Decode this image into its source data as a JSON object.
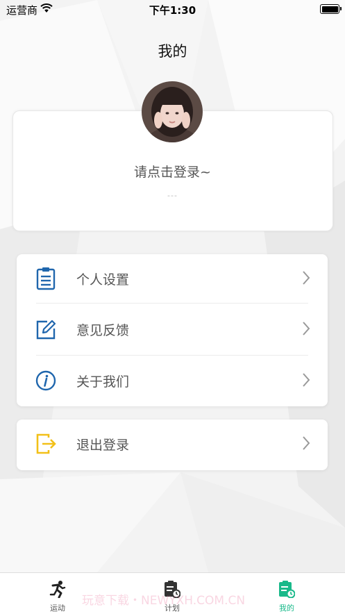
{
  "status_bar": {
    "carrier": "运营商",
    "time": "下午1:30"
  },
  "header": {
    "title": "我的"
  },
  "profile": {
    "login_prompt": "请点击登录~",
    "subtitle": "---"
  },
  "menu": {
    "items": [
      {
        "label": "个人设置",
        "icon": "clipboard-list-icon"
      },
      {
        "label": "意见反馈",
        "icon": "edit-icon"
      },
      {
        "label": "关于我们",
        "icon": "info-icon"
      }
    ]
  },
  "logout": {
    "label": "退出登录",
    "icon": "logout-icon"
  },
  "tabbar": {
    "tabs": [
      {
        "label": "运动",
        "icon": "running-icon"
      },
      {
        "label": "计划",
        "icon": "plan-icon"
      },
      {
        "label": "我的",
        "icon": "profile-icon",
        "active": true
      }
    ]
  },
  "watermark": "玩意下载・NEWYXH.COM.CN",
  "colors": {
    "accent": "#19b98a",
    "icon_blue": "#1f66ad",
    "logout_yellow": "#f2c018"
  }
}
